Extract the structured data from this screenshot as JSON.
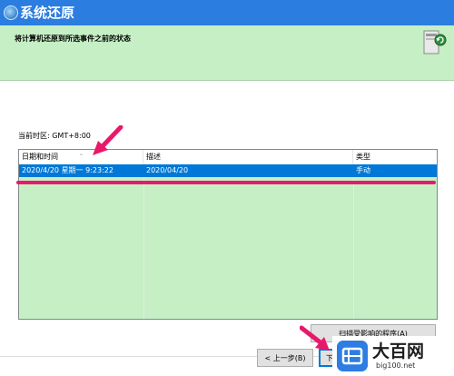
{
  "window": {
    "title": "系统还原"
  },
  "header": {
    "text": "将计算机还原到所选事件之前的状态"
  },
  "timezone": "当前时区: GMT+8:00",
  "table": {
    "columns": [
      "日期和时间",
      "描述",
      "类型"
    ],
    "rows": [
      {
        "datetime": "2020/4/20 星期一 9:23:22",
        "description": "2020/04/20",
        "type": "手动"
      }
    ],
    "selection_color": "#0078d7"
  },
  "buttons": {
    "scan": "扫描受影响的程序(A)",
    "back": "< 上一步(B)",
    "next": "下"
  },
  "watermark": {
    "name": "大百网",
    "url": "big100.net"
  },
  "colors": {
    "titlebar": "#2b7de0",
    "header_bg": "#c6efc6",
    "annotation": "#e8196a"
  }
}
